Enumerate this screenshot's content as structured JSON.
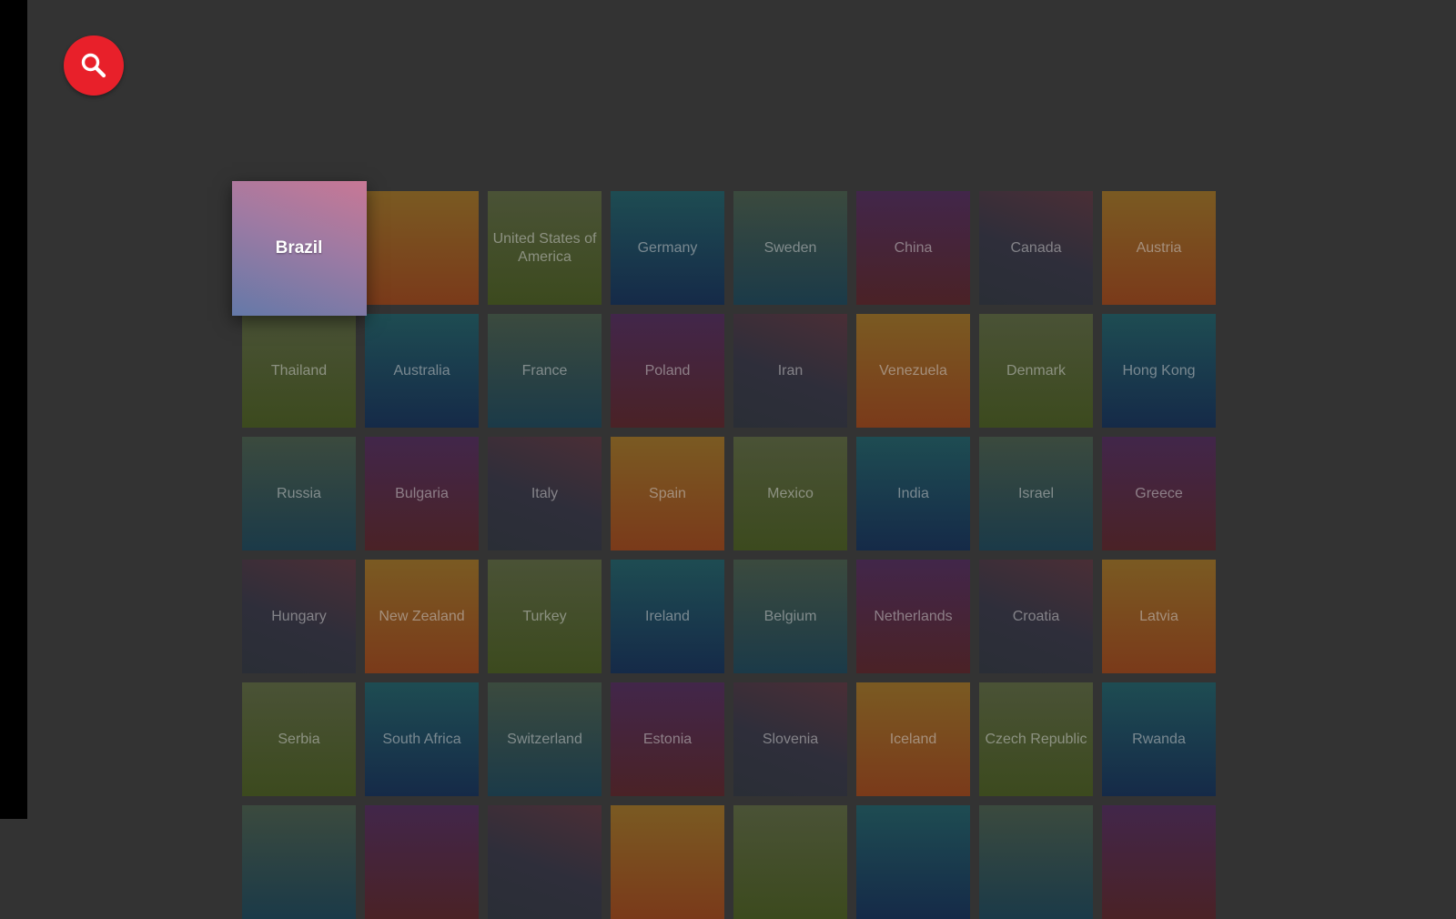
{
  "search": {
    "icon": "search-icon",
    "button_color": "#e8202a"
  },
  "focused_index": 0,
  "countries": [
    "Brazil",
    "",
    "United States of America",
    "Germany",
    "Sweden",
    "China",
    "Canada",
    "Austria",
    "Thailand",
    "Australia",
    "France",
    "Poland",
    "Iran",
    "Venezuela",
    "Denmark",
    "Hong Kong",
    "Russia",
    "Bulgaria",
    "Italy",
    "Spain",
    "Mexico",
    "India",
    "Israel",
    "Greece",
    "Hungary",
    "New Zealand",
    "Turkey",
    "Ireland",
    "Belgium",
    "Netherlands",
    "Croatia",
    "Latvia",
    "Serbia",
    "South Africa",
    "Switzerland",
    "Estonia",
    "Slovenia",
    "Iceland",
    "Czech Republic",
    "Rwanda",
    "",
    "",
    "",
    "",
    "",
    "",
    "",
    ""
  ]
}
